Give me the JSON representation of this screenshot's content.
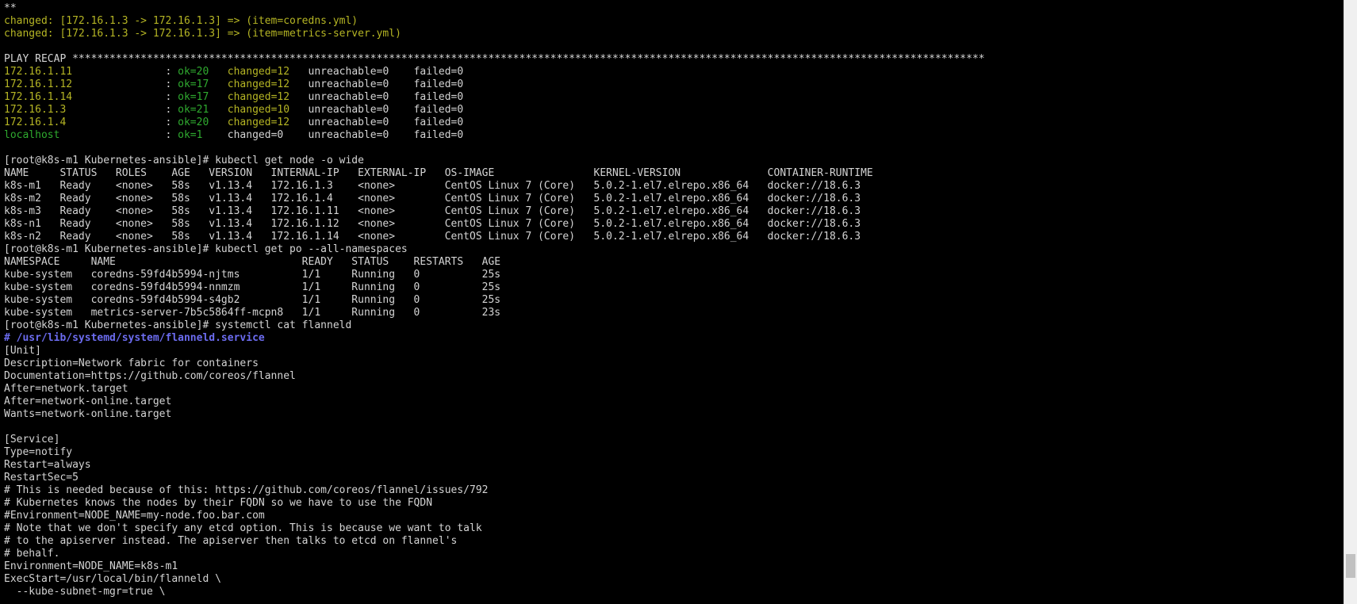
{
  "colors": {
    "background": "#000000",
    "text": "#d4d4d4",
    "changed": "#b5b524",
    "ok": "#2faa2f",
    "comment_path": "#6c6cf0",
    "scrollbar_track": "#f0f0f0",
    "scrollbar_thumb": "#c1c1c1"
  },
  "scroll_position": 0.96,
  "lines": [
    [
      {
        "t": "**",
        "c": "w"
      }
    ],
    [
      {
        "t": "changed: [172.16.1.3 -> 172.16.1.3] => (item=coredns.yml)",
        "c": "y"
      }
    ],
    [
      {
        "t": "changed: [172.16.1.3 -> 172.16.1.3] => (item=metrics-server.yml)",
        "c": "y"
      }
    ],
    [],
    [
      {
        "t": "PLAY RECAP ***************************************************************************************************************************************************",
        "c": "w"
      }
    ],
    [
      {
        "t": "172.16.1.11               ",
        "c": "y"
      },
      {
        "t": ": ",
        "c": "w"
      },
      {
        "t": "ok=20   ",
        "c": "g"
      },
      {
        "t": "changed=12   ",
        "c": "y"
      },
      {
        "t": "unreachable=0    failed=0",
        "c": "w"
      }
    ],
    [
      {
        "t": "172.16.1.12               ",
        "c": "y"
      },
      {
        "t": ": ",
        "c": "w"
      },
      {
        "t": "ok=17   ",
        "c": "g"
      },
      {
        "t": "changed=12   ",
        "c": "y"
      },
      {
        "t": "unreachable=0    failed=0",
        "c": "w"
      }
    ],
    [
      {
        "t": "172.16.1.14               ",
        "c": "y"
      },
      {
        "t": ": ",
        "c": "w"
      },
      {
        "t": "ok=17   ",
        "c": "g"
      },
      {
        "t": "changed=12   ",
        "c": "y"
      },
      {
        "t": "unreachable=0    failed=0",
        "c": "w"
      }
    ],
    [
      {
        "t": "172.16.1.3                ",
        "c": "y"
      },
      {
        "t": ": ",
        "c": "w"
      },
      {
        "t": "ok=21   ",
        "c": "g"
      },
      {
        "t": "changed=10   ",
        "c": "y"
      },
      {
        "t": "unreachable=0    failed=0",
        "c": "w"
      }
    ],
    [
      {
        "t": "172.16.1.4                ",
        "c": "y"
      },
      {
        "t": ": ",
        "c": "w"
      },
      {
        "t": "ok=20   ",
        "c": "g"
      },
      {
        "t": "changed=12   ",
        "c": "y"
      },
      {
        "t": "unreachable=0    failed=0",
        "c": "w"
      }
    ],
    [
      {
        "t": "localhost                 ",
        "c": "g"
      },
      {
        "t": ": ",
        "c": "w"
      },
      {
        "t": "ok=1    ",
        "c": "g"
      },
      {
        "t": "changed=0    unreachable=0    failed=0",
        "c": "w"
      }
    ],
    [],
    [
      {
        "t": "[root@k8s-m1 Kubernetes-ansible]# kubectl get node -o wide",
        "c": "w"
      }
    ],
    [
      {
        "t": "NAME     STATUS   ROLES    AGE   VERSION   INTERNAL-IP   EXTERNAL-IP   OS-IMAGE                KERNEL-VERSION              CONTAINER-RUNTIME",
        "c": "w"
      }
    ],
    [
      {
        "t": "k8s-m1   Ready    <none>   58s   v1.13.4   172.16.1.3    <none>        CentOS Linux 7 (Core)   5.0.2-1.el7.elrepo.x86_64   docker://18.6.3",
        "c": "w"
      }
    ],
    [
      {
        "t": "k8s-m2   Ready    <none>   58s   v1.13.4   172.16.1.4    <none>        CentOS Linux 7 (Core)   5.0.2-1.el7.elrepo.x86_64   docker://18.6.3",
        "c": "w"
      }
    ],
    [
      {
        "t": "k8s-m3   Ready    <none>   58s   v1.13.4   172.16.1.11   <none>        CentOS Linux 7 (Core)   5.0.2-1.el7.elrepo.x86_64   docker://18.6.3",
        "c": "w"
      }
    ],
    [
      {
        "t": "k8s-n1   Ready    <none>   58s   v1.13.4   172.16.1.12   <none>        CentOS Linux 7 (Core)   5.0.2-1.el7.elrepo.x86_64   docker://18.6.3",
        "c": "w"
      }
    ],
    [
      {
        "t": "k8s-n2   Ready    <none>   58s   v1.13.4   172.16.1.14   <none>        CentOS Linux 7 (Core)   5.0.2-1.el7.elrepo.x86_64   docker://18.6.3",
        "c": "w"
      }
    ],
    [
      {
        "t": "[root@k8s-m1 Kubernetes-ansible]# kubectl get po --all-namespaces",
        "c": "w"
      }
    ],
    [
      {
        "t": "NAMESPACE     NAME                              READY   STATUS    RESTARTS   AGE",
        "c": "w"
      }
    ],
    [
      {
        "t": "kube-system   coredns-59fd4b5994-njtms          1/1     Running   0          25s",
        "c": "w"
      }
    ],
    [
      {
        "t": "kube-system   coredns-59fd4b5994-nnmzm          1/1     Running   0          25s",
        "c": "w"
      }
    ],
    [
      {
        "t": "kube-system   coredns-59fd4b5994-s4gb2          1/1     Running   0          25s",
        "c": "w"
      }
    ],
    [
      {
        "t": "kube-system   metrics-server-7b5c5864ff-mcpn8   1/1     Running   0          23s",
        "c": "w"
      }
    ],
    [
      {
        "t": "[root@k8s-m1 Kubernetes-ansible]# systemctl cat flanneld",
        "c": "w"
      }
    ],
    [
      {
        "t": "# /usr/lib/systemd/system/flanneld.service",
        "c": "b"
      }
    ],
    [
      {
        "t": "[Unit]",
        "c": "w"
      }
    ],
    [
      {
        "t": "Description=Network fabric for containers",
        "c": "w"
      }
    ],
    [
      {
        "t": "Documentation=https://github.com/coreos/flannel",
        "c": "w"
      }
    ],
    [
      {
        "t": "After=network.target",
        "c": "w"
      }
    ],
    [
      {
        "t": "After=network-online.target",
        "c": "w"
      }
    ],
    [
      {
        "t": "Wants=network-online.target",
        "c": "w"
      }
    ],
    [],
    [
      {
        "t": "[Service]",
        "c": "w"
      }
    ],
    [
      {
        "t": "Type=notify",
        "c": "w"
      }
    ],
    [
      {
        "t": "Restart=always",
        "c": "w"
      }
    ],
    [
      {
        "t": "RestartSec=5",
        "c": "w"
      }
    ],
    [
      {
        "t": "# This is needed because of this: https://github.com/coreos/flannel/issues/792",
        "c": "w"
      }
    ],
    [
      {
        "t": "# Kubernetes knows the nodes by their FQDN so we have to use the FQDN",
        "c": "w"
      }
    ],
    [
      {
        "t": "#Environment=NODE_NAME=my-node.foo.bar.com",
        "c": "w"
      }
    ],
    [
      {
        "t": "# Note that we don't specify any etcd option. This is because we want to talk",
        "c": "w"
      }
    ],
    [
      {
        "t": "# to the apiserver instead. The apiserver then talks to etcd on flannel's",
        "c": "w"
      }
    ],
    [
      {
        "t": "# behalf.",
        "c": "w"
      }
    ],
    [
      {
        "t": "Environment=NODE_NAME=k8s-m1",
        "c": "w"
      }
    ],
    [
      {
        "t": "ExecStart=/usr/local/bin/flanneld \\",
        "c": "w"
      }
    ],
    [
      {
        "t": "  --kube-subnet-mgr=true \\",
        "c": "w"
      }
    ]
  ]
}
